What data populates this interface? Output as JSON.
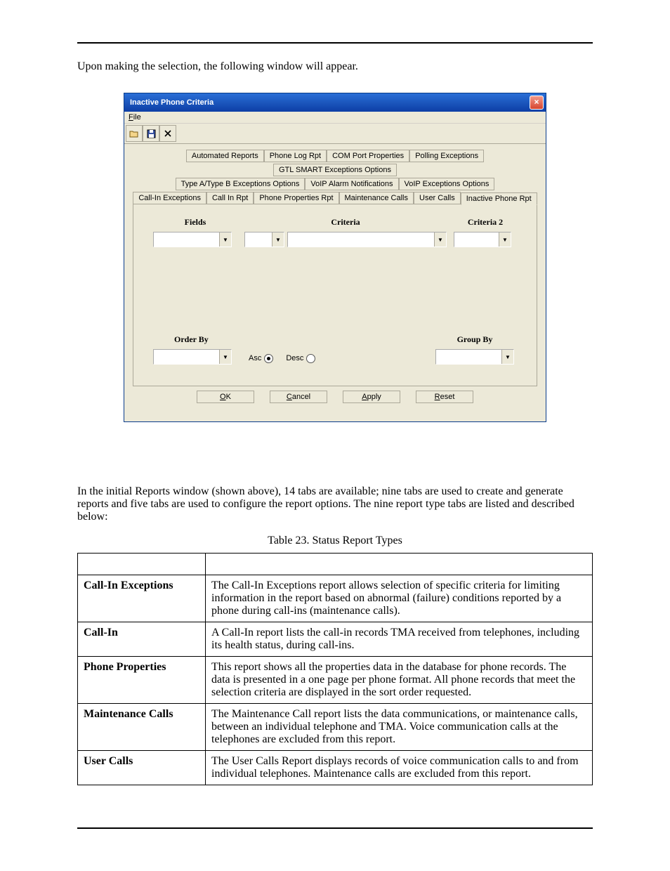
{
  "intro_text": "Upon making the selection, the following window will appear.",
  "dialog": {
    "title": "Inactive Phone Criteria",
    "menu_file": "File",
    "menu_file_key": "F",
    "toolbar": {
      "open": "open",
      "save": "save",
      "delete": "delete"
    },
    "tabs_row1": [
      "Automated Reports",
      "Phone Log Rpt",
      "COM Port Properties",
      "Polling Exceptions",
      "GTL SMART Exceptions Options"
    ],
    "tabs_row2": [
      "Type A/Type B Exceptions Options",
      "VoIP Alarm Notifications",
      "VoIP Exceptions Options"
    ],
    "tabs_row3": [
      "Call-In Exceptions",
      "Call In Rpt",
      "Phone Properties Rpt",
      "Maintenance Calls",
      "User Calls",
      "Inactive Phone Rpt"
    ],
    "selected_tab": "Inactive Phone Rpt",
    "headers": {
      "fields": "Fields",
      "criteria": "Criteria",
      "criteria2": "Criteria 2"
    },
    "orderby_label": "Order By",
    "groupby_label": "Group By",
    "asc_label": "Asc",
    "desc_label": "Desc",
    "buttons": {
      "ok": "OK",
      "ok_key": "O",
      "cancel": "Cancel",
      "cancel_key": "C",
      "apply": "Apply",
      "apply_key": "A",
      "reset": "Reset",
      "reset_key": "R"
    }
  },
  "para2": "In the initial Reports window (shown above), 14 tabs are available; nine tabs are used to create and generate reports and five tabs are used to configure the report options.  The nine report type tabs are listed and described below:",
  "table_caption": "Table 23.  Status Report Types",
  "rows": [
    {
      "name": "Call-In Exceptions",
      "desc": "The Call-In Exceptions report allows selection of specific criteria for limiting information in the report based on abnormal (failure) conditions reported by a phone during call-ins (maintenance calls)."
    },
    {
      "name": "Call-In",
      "desc": "A Call-In report lists the call-in records TMA received from telephones, including its health status, during call-ins."
    },
    {
      "name": "Phone Properties",
      "desc": "This report shows all the properties data in the database for phone records.  The data is presented in a one page per phone format.  All phone records that meet the selection criteria are displayed in the sort order requested."
    },
    {
      "name": "Maintenance Calls",
      "desc": "The Maintenance Call report lists the data communications, or maintenance calls, between an individual telephone and TMA.  Voice communication calls at the telephones are excluded from this report."
    },
    {
      "name": "User Calls",
      "desc": "The User Calls Report displays records of voice communication calls to and from individual telephones.  Maintenance calls are excluded from this report."
    }
  ]
}
